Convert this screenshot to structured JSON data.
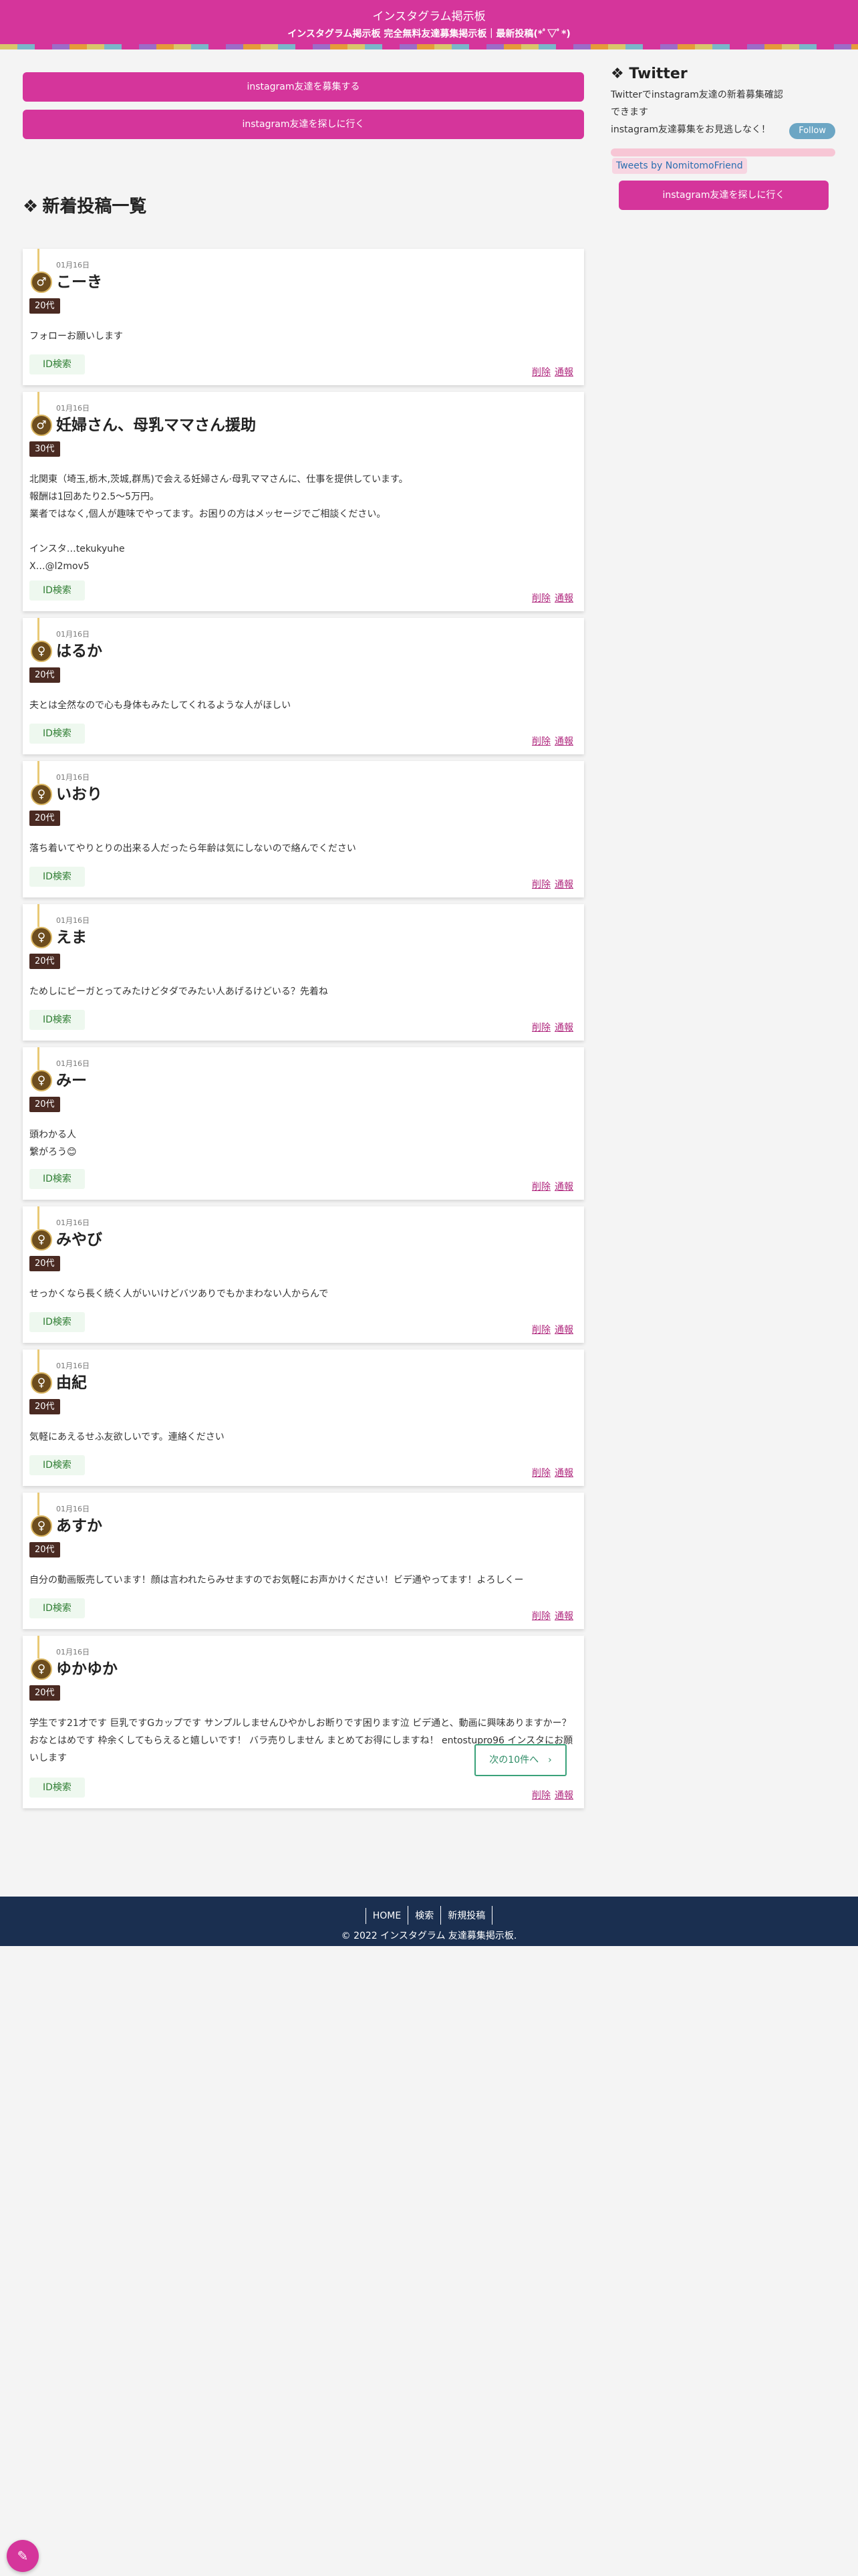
{
  "header": {
    "title": "インスタグラム掲示板",
    "subtitle": "インスタグラム掲示板 完全無料友達募集掲示板｜最新投稿(*ﾟ▽ﾟ*)"
  },
  "cta": {
    "recruit_label": "instagram友達を募集する",
    "find_label": "instagram友達を探しに行く"
  },
  "section": {
    "deco": "❖",
    "heading": "新着投稿一覧"
  },
  "posts": [
    {
      "date": "01月16日",
      "gender": "male",
      "icon": "♂",
      "name": "こーき",
      "age": "20代",
      "body": "フォローお願いします",
      "id_label": "ID検索",
      "delete_label": "削除",
      "report_label": "通報"
    },
    {
      "date": "01月16日",
      "gender": "male",
      "icon": "♂",
      "name": "妊婦さん、母乳ママさん援助",
      "age": "30代",
      "body": "北関東（埼玉,栃木,茨城,群馬)で会える妊婦さん·母乳ママさんに、仕事を提供しています。\n報酬は1回あたり2.5〜5万円。\n業者ではなく,個人が趣味でやってます。お困りの方はメッセージでご相談ください。\n\nインスタ…tekukyuhe\nX…@l2mov5",
      "id_label": "ID検索",
      "delete_label": "削除",
      "report_label": "通報"
    },
    {
      "date": "01月16日",
      "gender": "female",
      "icon": "♀",
      "name": "はるか",
      "age": "20代",
      "body": "夫とは全然なので心も身体もみたしてくれるような人がほしい",
      "id_label": "ID検索",
      "delete_label": "削除",
      "report_label": "通報"
    },
    {
      "date": "01月16日",
      "gender": "female",
      "icon": "♀",
      "name": "いおり",
      "age": "20代",
      "body": "落ち着いてやりとりの出来る人だったら年齢は気にしないので絡んでください",
      "id_label": "ID検索",
      "delete_label": "削除",
      "report_label": "通報"
    },
    {
      "date": "01月16日",
      "gender": "female",
      "icon": "♀",
      "name": "えま",
      "age": "20代",
      "body": "ためしにピーガとってみたけどタダでみたい人あげるけどいる？先着ね",
      "id_label": "ID検索",
      "delete_label": "削除",
      "report_label": "通報"
    },
    {
      "date": "01月16日",
      "gender": "female",
      "icon": "♀",
      "name": "みー",
      "age": "20代",
      "body": "頭わかる人\n繋がろう😊",
      "id_label": "ID検索",
      "delete_label": "削除",
      "report_label": "通報"
    },
    {
      "date": "01月16日",
      "gender": "female",
      "icon": "♀",
      "name": "みやび",
      "age": "20代",
      "body": "せっかくなら長く続く人がいいけどバツありでもかまわない人からんで",
      "id_label": "ID検索",
      "delete_label": "削除",
      "report_label": "通報"
    },
    {
      "date": "01月16日",
      "gender": "female",
      "icon": "♀",
      "name": "由紀",
      "age": "20代",
      "body": "気軽にあえるせふ友欲しいです。連絡ください",
      "id_label": "ID検索",
      "delete_label": "削除",
      "report_label": "通報"
    },
    {
      "date": "01月16日",
      "gender": "female",
      "icon": "♀",
      "name": "あすか",
      "age": "20代",
      "body": "自分の動画販売しています！顔は言われたらみせますのでお気軽にお声かけください！ビデ通やってます！よろしくー",
      "id_label": "ID検索",
      "delete_label": "削除",
      "report_label": "通報"
    },
    {
      "date": "01月16日",
      "gender": "female",
      "icon": "♀",
      "name": "ゆかゆか",
      "age": "20代",
      "body": "学生です21才です 巨乳ですGカップです サンプルしませんひやかしお断りです困ります泣 ビデ通と、動画に興味ありますかー？おなとはめです 枠余くしてもらえると嬉しいです！ バラ売りしません まとめてお得にしますね！ entostupro96 インスタにお願いします",
      "id_label": "ID検索",
      "delete_label": "削除",
      "report_label": "通報"
    }
  ],
  "pagination": {
    "next_label": "次の10件へ　›"
  },
  "sidebar": {
    "deco": "❖",
    "title": "Twitter",
    "text": "Twitterでinstagram友達の新着募集確認できます\ninstagram友達募集をお見逃しなく！",
    "follow_label": "Follow",
    "tweets_label": "Tweets by NomitomoFriend",
    "cta_label": "instagram友達を探しに行く"
  },
  "footer": {
    "nav": [
      "HOME",
      "検索",
      "新規投稿"
    ],
    "copyright": "© 2022 インスタグラム 友達募集掲示板."
  },
  "fab": {
    "icon": "pencil-icon",
    "glyph": "✎"
  },
  "colors": {
    "brand": "#d5359b",
    "footer": "#1a2f50",
    "badge": "#4a2a22",
    "id_button": "#eef8ef",
    "icon_ring": "#d9b560"
  }
}
